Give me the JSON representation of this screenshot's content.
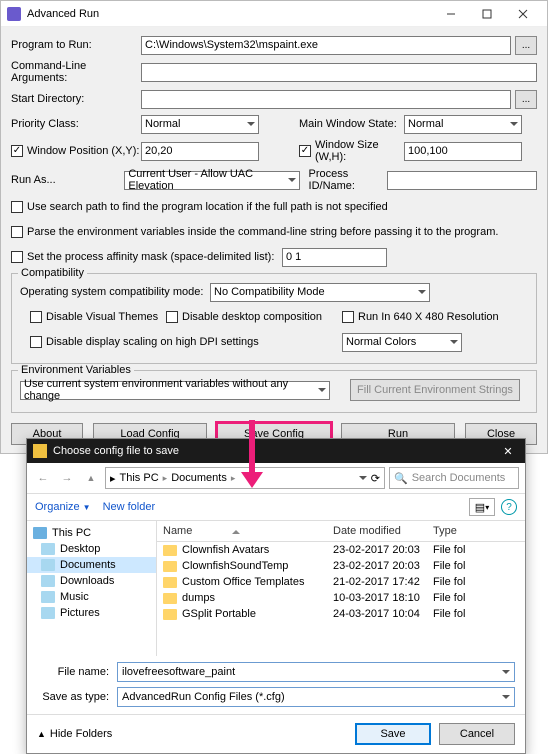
{
  "main": {
    "title": "Advanced Run",
    "labels": {
      "program": "Program to Run:",
      "args": "Command-Line Arguments:",
      "startdir": "Start Directory:",
      "priority": "Priority Class:",
      "mws": "Main Window State:",
      "wpos": "Window Position (X,Y):",
      "wsize": "Window Size (W,H):",
      "runas": "Run As...",
      "procid": "Process ID/Name:",
      "opt1": "Use search path to find the program location if the full path is not specified",
      "opt2": "Parse the environment variables inside the command-line string before passing it to the program.",
      "opt3": "Set the process affinity mask (space-delimited list):",
      "compat_group": "Compatibility",
      "osmode": "Operating system compatibility mode:",
      "disvis": "Disable Visual Themes",
      "disdesk": "Disable desktop composition",
      "run640": "Run In 640 X 480 Resolution",
      "disdpi": "Disable display scaling on high DPI settings",
      "env_group": "Environment Variables",
      "fillenv": "Fill Current Environment Strings"
    },
    "values": {
      "program": "C:\\Windows\\System32\\mspaint.exe",
      "priority": "Normal",
      "mws": "Normal",
      "wpos": "20,20",
      "wsize": "100,100",
      "runas": "Current User - Allow UAC Elevation",
      "affinity": "0 1",
      "osmode": "No Compatibility Mode",
      "colors": "Normal Colors",
      "envmode": "Use current system environment variables without any change"
    },
    "buttons": {
      "about": "About",
      "load": "Load Config",
      "save": "Save Config",
      "run": "Run",
      "close": "Close"
    }
  },
  "dialog": {
    "title": "Choose config file to save",
    "breadcrumb": {
      "root": "This PC",
      "folder": "Documents"
    },
    "search_placeholder": "Search Documents",
    "toolbar": {
      "organize": "Organize",
      "newfolder": "New folder"
    },
    "tree": {
      "pc": "This PC",
      "desktop": "Desktop",
      "documents": "Documents",
      "downloads": "Downloads",
      "music": "Music",
      "pictures": "Pictures"
    },
    "cols": {
      "name": "Name",
      "date": "Date modified",
      "type": "Type"
    },
    "files": [
      {
        "name": "Clownfish Avatars",
        "date": "23-02-2017 20:03",
        "type": "File fol"
      },
      {
        "name": "ClownfishSoundTemp",
        "date": "23-02-2017 20:03",
        "type": "File fol"
      },
      {
        "name": "Custom Office Templates",
        "date": "21-02-2017 17:42",
        "type": "File fol"
      },
      {
        "name": "dumps",
        "date": "10-03-2017 18:10",
        "type": "File fol"
      },
      {
        "name": "GSplit Portable",
        "date": "24-03-2017 10:04",
        "type": "File fol"
      }
    ],
    "filename_label": "File name:",
    "filename": "ilovefreesoftware_paint",
    "saveas_label": "Save as type:",
    "saveas": "AdvancedRun Config Files (*.cfg)",
    "hide": "Hide Folders",
    "save": "Save",
    "cancel": "Cancel"
  }
}
